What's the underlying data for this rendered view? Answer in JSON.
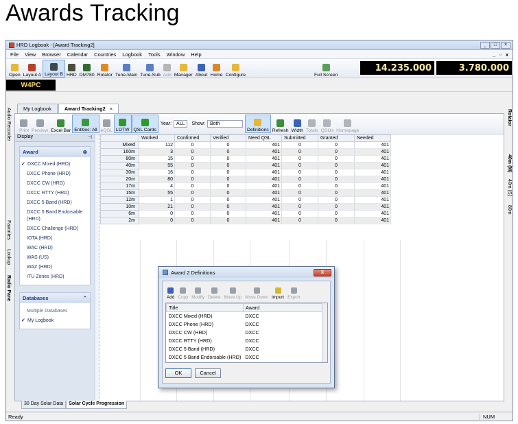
{
  "heading": "Awards Tracking",
  "window": {
    "title": "HRD Logbook - [Award Tracking2]"
  },
  "menu": [
    "File",
    "View",
    "Browser",
    "Calendar",
    "Countries",
    "Logbook",
    "Tools",
    "Window",
    "Help"
  ],
  "toolbar": {
    "buttons": [
      {
        "label": "Open",
        "icon": "folder-icon",
        "color": "#e6b83a"
      },
      {
        "label": "Layout A",
        "icon": "layout-a-icon",
        "color": "#b8412c"
      },
      {
        "label": "Layout B",
        "icon": "layout-b-icon",
        "color": "#3d4a4c"
      },
      {
        "label": "HRD",
        "icon": "hrd-icon",
        "color": "#4a4f3a"
      },
      {
        "label": "DM780",
        "icon": "dm780-icon",
        "color": "#2f6b2f"
      },
      {
        "label": "Rotator",
        "icon": "rotator-icon",
        "color": "#e28a22"
      },
      {
        "label": "Tune-Main",
        "icon": "tune-main-icon",
        "color": "#5a7fc4"
      },
      {
        "label": "Tune-Sub",
        "icon": "tune-sub-icon",
        "color": "#5a7fc4"
      },
      {
        "label": "Add",
        "icon": "add-icon",
        "color": "#b6b6b6"
      },
      {
        "label": "Manager",
        "icon": "manager-icon",
        "color": "#e6b83a"
      },
      {
        "label": "About",
        "icon": "about-icon",
        "color": "#3a63b6"
      },
      {
        "label": "Home",
        "icon": "home-icon",
        "color": "#d9892b"
      },
      {
        "label": "Configure",
        "icon": "configure-icon",
        "color": "#e6b83a"
      }
    ],
    "fullscreen": "Full Screen",
    "freq1": "14.235.000",
    "freq2": "3.780.000"
  },
  "callsign": "W4PC",
  "tabs": {
    "my_logbook": "My Logbook",
    "award_tracking": "Award Tracking2",
    "close": "×"
  },
  "side_left": [
    "Audio Recorder",
    "Favorites",
    "Lookup",
    "Radio Pane"
  ],
  "side_right": [
    "Rotator",
    "40m (M)",
    "40m (S)",
    "80m"
  ],
  "award_toolbar": {
    "buttons": [
      "Print",
      "Preview",
      "Excel Bar",
      "Entities: All",
      "eQSL",
      "LOTW",
      "QSL Cards"
    ],
    "year_label": "Year:",
    "year_value": "ALL",
    "show_label": "Show:",
    "show_value": "Both",
    "buttons2": [
      "Definitions",
      "Refresh",
      "Width",
      "Totals",
      "QSOs",
      "Homepage"
    ]
  },
  "panel": {
    "title": "Display",
    "award_header": "Award",
    "awards": [
      "DXCC Mixed (HRD)",
      "DXCC Phone (HRD)",
      "DXCC CW (HRD)",
      "DXCC RTTY (HRD)",
      "DXCC 5 Band (HRD)",
      "DXCC 5 Band Endorsable (HRD)",
      "DXCC Challenge (HRD)",
      "IOTA (HRD)",
      "WAC (HRD)",
      "WAS (US)",
      "WAZ (HRD)",
      "ITU Zones (HRD)"
    ],
    "databases_header": "Databases",
    "db_sub": "Multiple Databases",
    "db_item": "My Logbook"
  },
  "grid": {
    "columns": [
      "Worked",
      "Confirmed",
      "Verified",
      "Need QSL",
      "Submitted",
      "Granted",
      "Needed"
    ],
    "rows": [
      {
        "band": "Mixed",
        "v": [
          "112",
          "0",
          "0",
          "401",
          "0",
          "0",
          "401"
        ]
      },
      {
        "band": "160m",
        "v": [
          "3",
          "0",
          "0",
          "401",
          "0",
          "0",
          "401"
        ]
      },
      {
        "band": "80m",
        "v": [
          "15",
          "0",
          "0",
          "401",
          "0",
          "0",
          "401"
        ]
      },
      {
        "band": "40m",
        "v": [
          "55",
          "0",
          "0",
          "401",
          "0",
          "0",
          "401"
        ]
      },
      {
        "band": "30m",
        "v": [
          "16",
          "0",
          "0",
          "401",
          "0",
          "0",
          "401"
        ]
      },
      {
        "band": "20m",
        "v": [
          "80",
          "0",
          "0",
          "401",
          "0",
          "0",
          "401"
        ]
      },
      {
        "band": "17m",
        "v": [
          "4",
          "0",
          "0",
          "401",
          "0",
          "0",
          "401"
        ]
      },
      {
        "band": "15m",
        "v": [
          "55",
          "0",
          "0",
          "401",
          "0",
          "0",
          "401"
        ]
      },
      {
        "band": "12m",
        "v": [
          "1",
          "0",
          "0",
          "401",
          "0",
          "0",
          "401"
        ]
      },
      {
        "band": "10m",
        "v": [
          "21",
          "0",
          "0",
          "401",
          "0",
          "0",
          "401"
        ]
      },
      {
        "band": "6m",
        "v": [
          "0",
          "0",
          "0",
          "401",
          "0",
          "0",
          "401"
        ]
      },
      {
        "band": "2m",
        "v": [
          "0",
          "0",
          "0",
          "401",
          "0",
          "0",
          "401"
        ]
      }
    ]
  },
  "dialog": {
    "title": "Award 2 Definitions",
    "close": "X",
    "tools": [
      "Add",
      "Copy",
      "Modify",
      "Delete",
      "Move Up",
      "Move Down",
      "Import",
      "Export"
    ],
    "col_title": "Title",
    "col_award": "Award",
    "rows": [
      {
        "title": "DXCC Mixed (HRD)",
        "award": "DXCC"
      },
      {
        "title": "DXCC Phone (HRD)",
        "award": "DXCC"
      },
      {
        "title": "DXCC CW (HRD)",
        "award": "DXCC"
      },
      {
        "title": "DXCC RTTY (HRD)",
        "award": "DXCC"
      },
      {
        "title": "DXCC 5 Band (HRD)",
        "award": "DXCC"
      },
      {
        "title": "DXCC 5 Band Endorsable (HRD)",
        "award": "DXCC"
      }
    ],
    "ok": "OK",
    "cancel": "Cancel"
  },
  "bottom_tabs": [
    "30 Day Solar Data",
    "Solar Cycle Progression"
  ],
  "status": {
    "text": "Ready",
    "num": "NUM"
  }
}
